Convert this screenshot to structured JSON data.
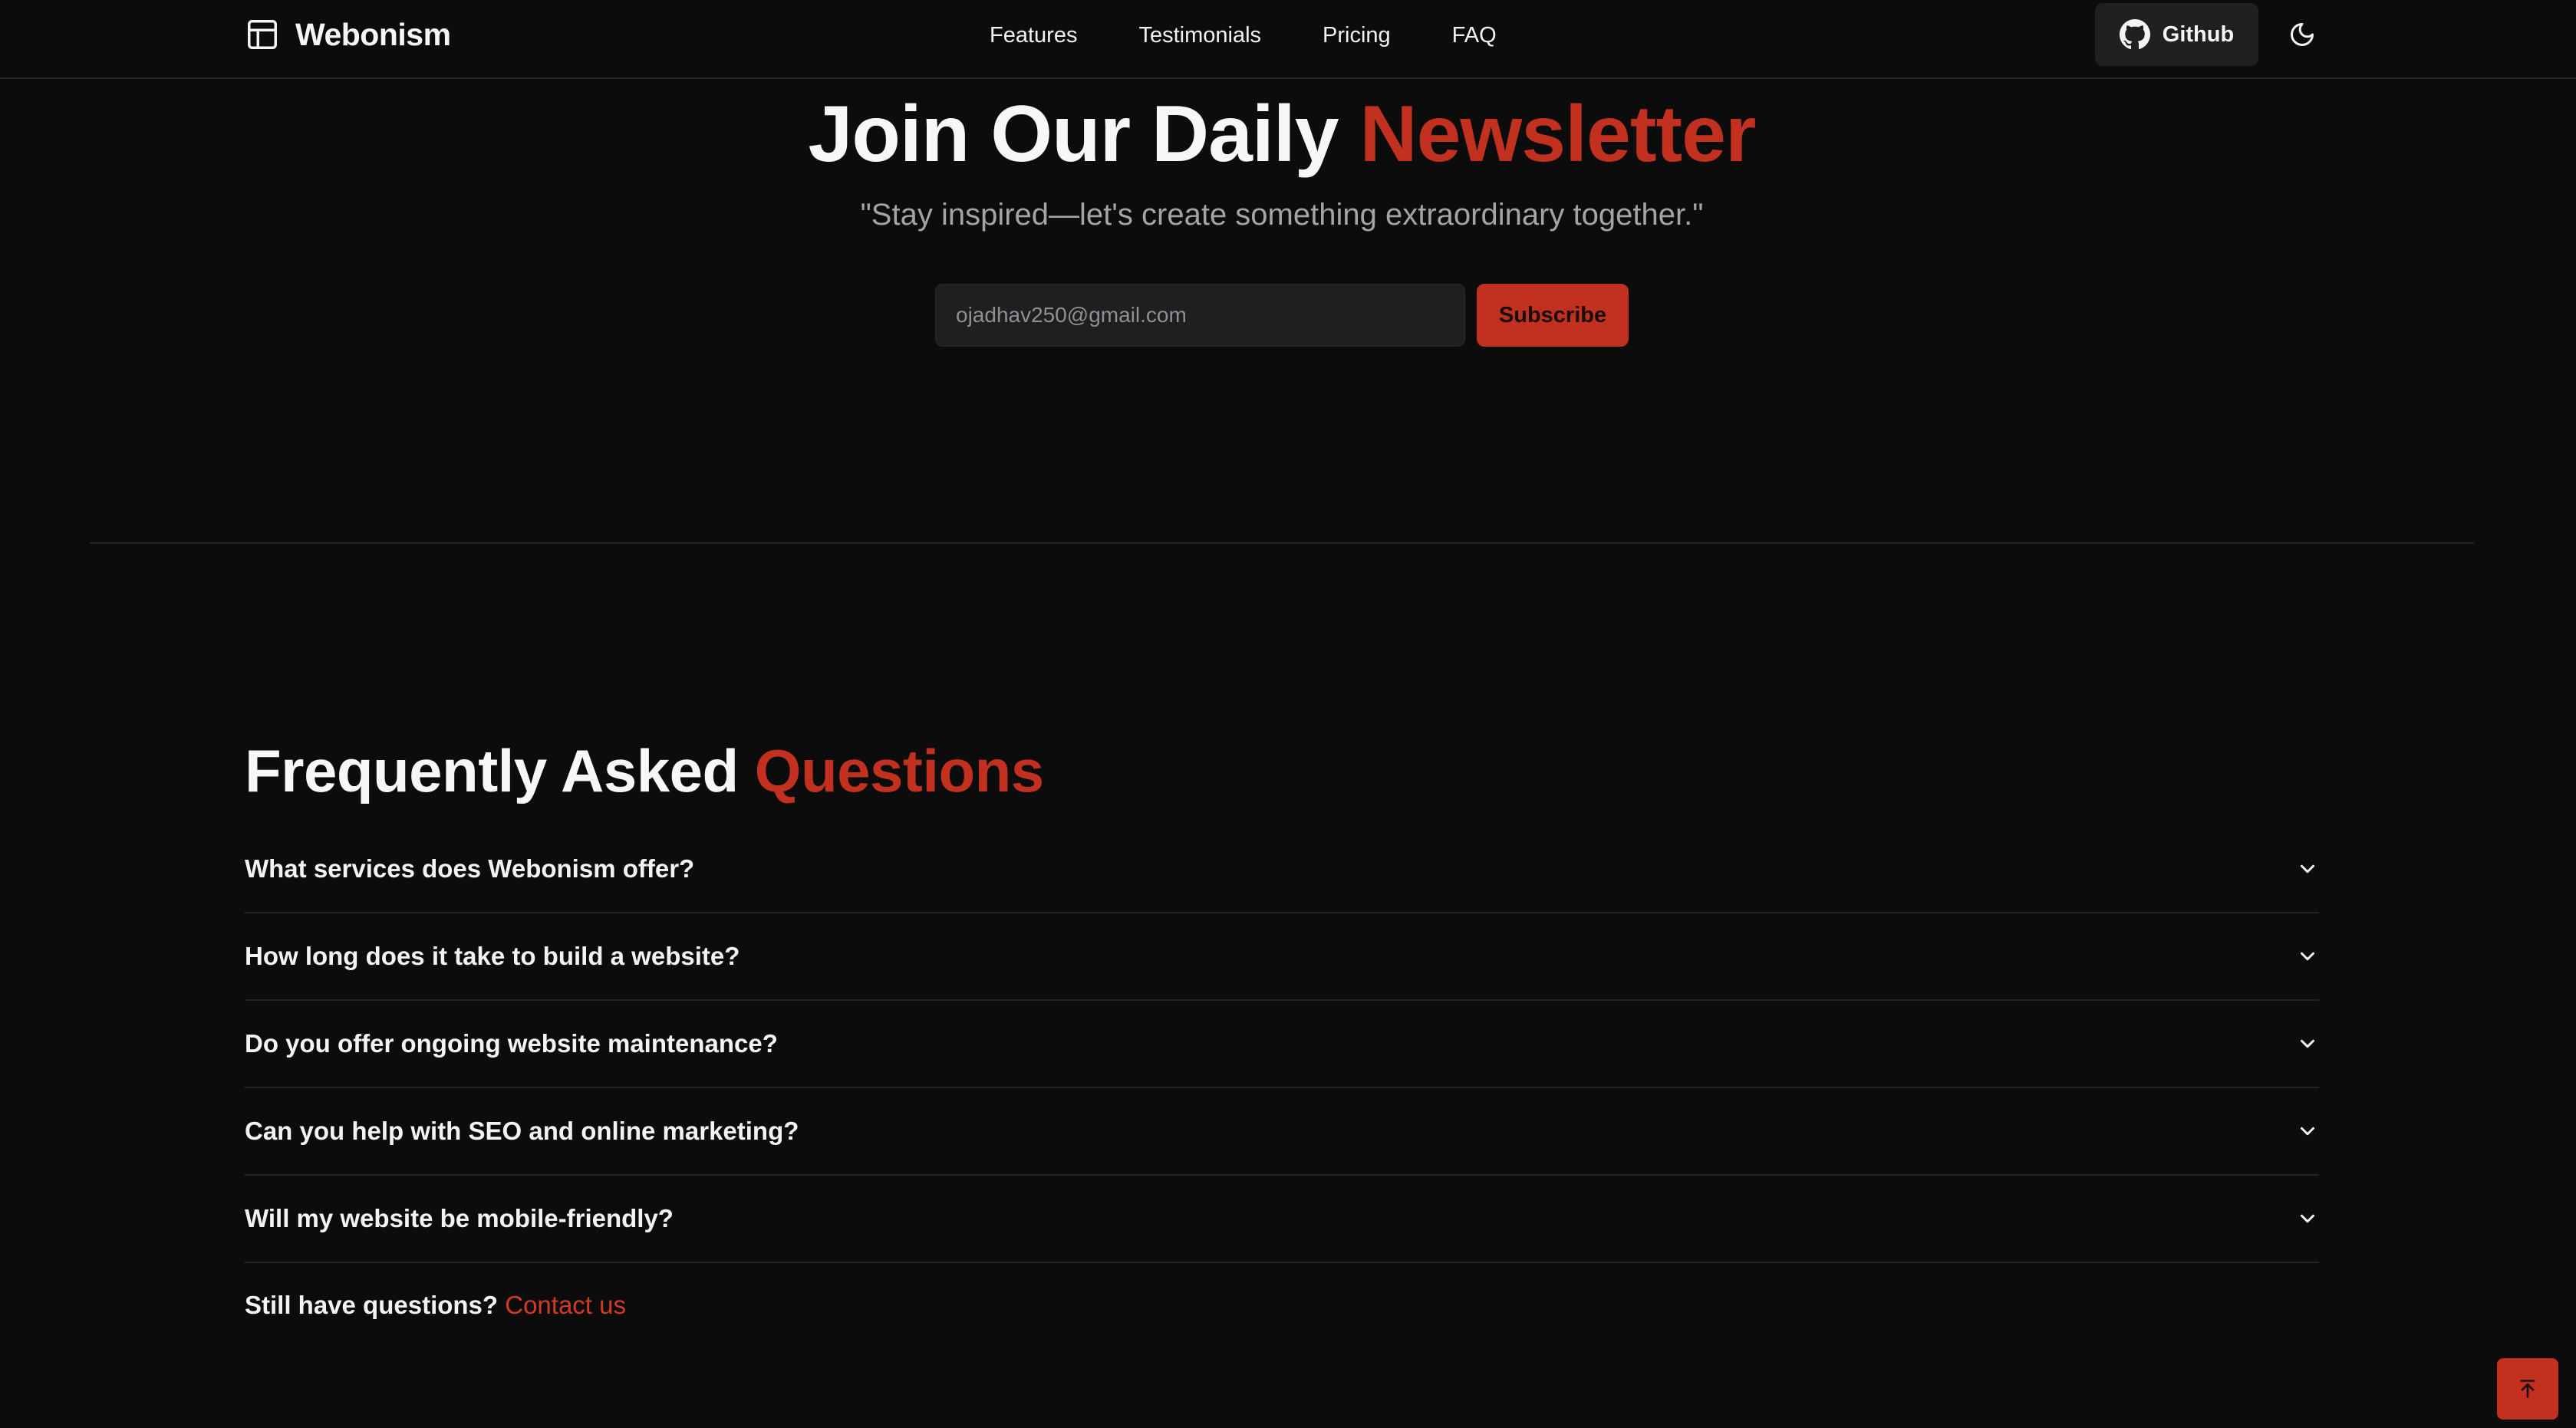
{
  "header": {
    "brand": "Webonism",
    "nav": [
      "Features",
      "Testimonials",
      "Pricing",
      "FAQ"
    ],
    "github_label": "Github",
    "icons": {
      "brand": "layout-panel-icon",
      "github": "github-icon",
      "theme": "moon-icon"
    }
  },
  "newsletter": {
    "title_main": "Join Our Daily",
    "title_accent": "Newsletter",
    "subtitle": "\"Stay inspired—let's create something extraordinary together.\"",
    "email_value": "ojadhav250@gmail.com",
    "subscribe_label": "Subscribe"
  },
  "faq": {
    "title_main": "Frequently Asked",
    "title_accent": "Questions",
    "questions": [
      "What services does Webonism offer?",
      "How long does it take to build a website?",
      "Do you offer ongoing website maintenance?",
      "Can you help with SEO and online marketing?",
      "Will my website be mobile-friendly?"
    ],
    "footer_text": "Still have questions?",
    "contact_label": "Contact us"
  },
  "scroll_top_icon": "arrow-up-to-line-icon",
  "colors": {
    "background": "#0c0c0d",
    "accent": "#c2311f",
    "input_bg": "#1f1f21",
    "button_dark": "#202023",
    "muted_text": "#a3a3a8",
    "divider": "#232326"
  }
}
